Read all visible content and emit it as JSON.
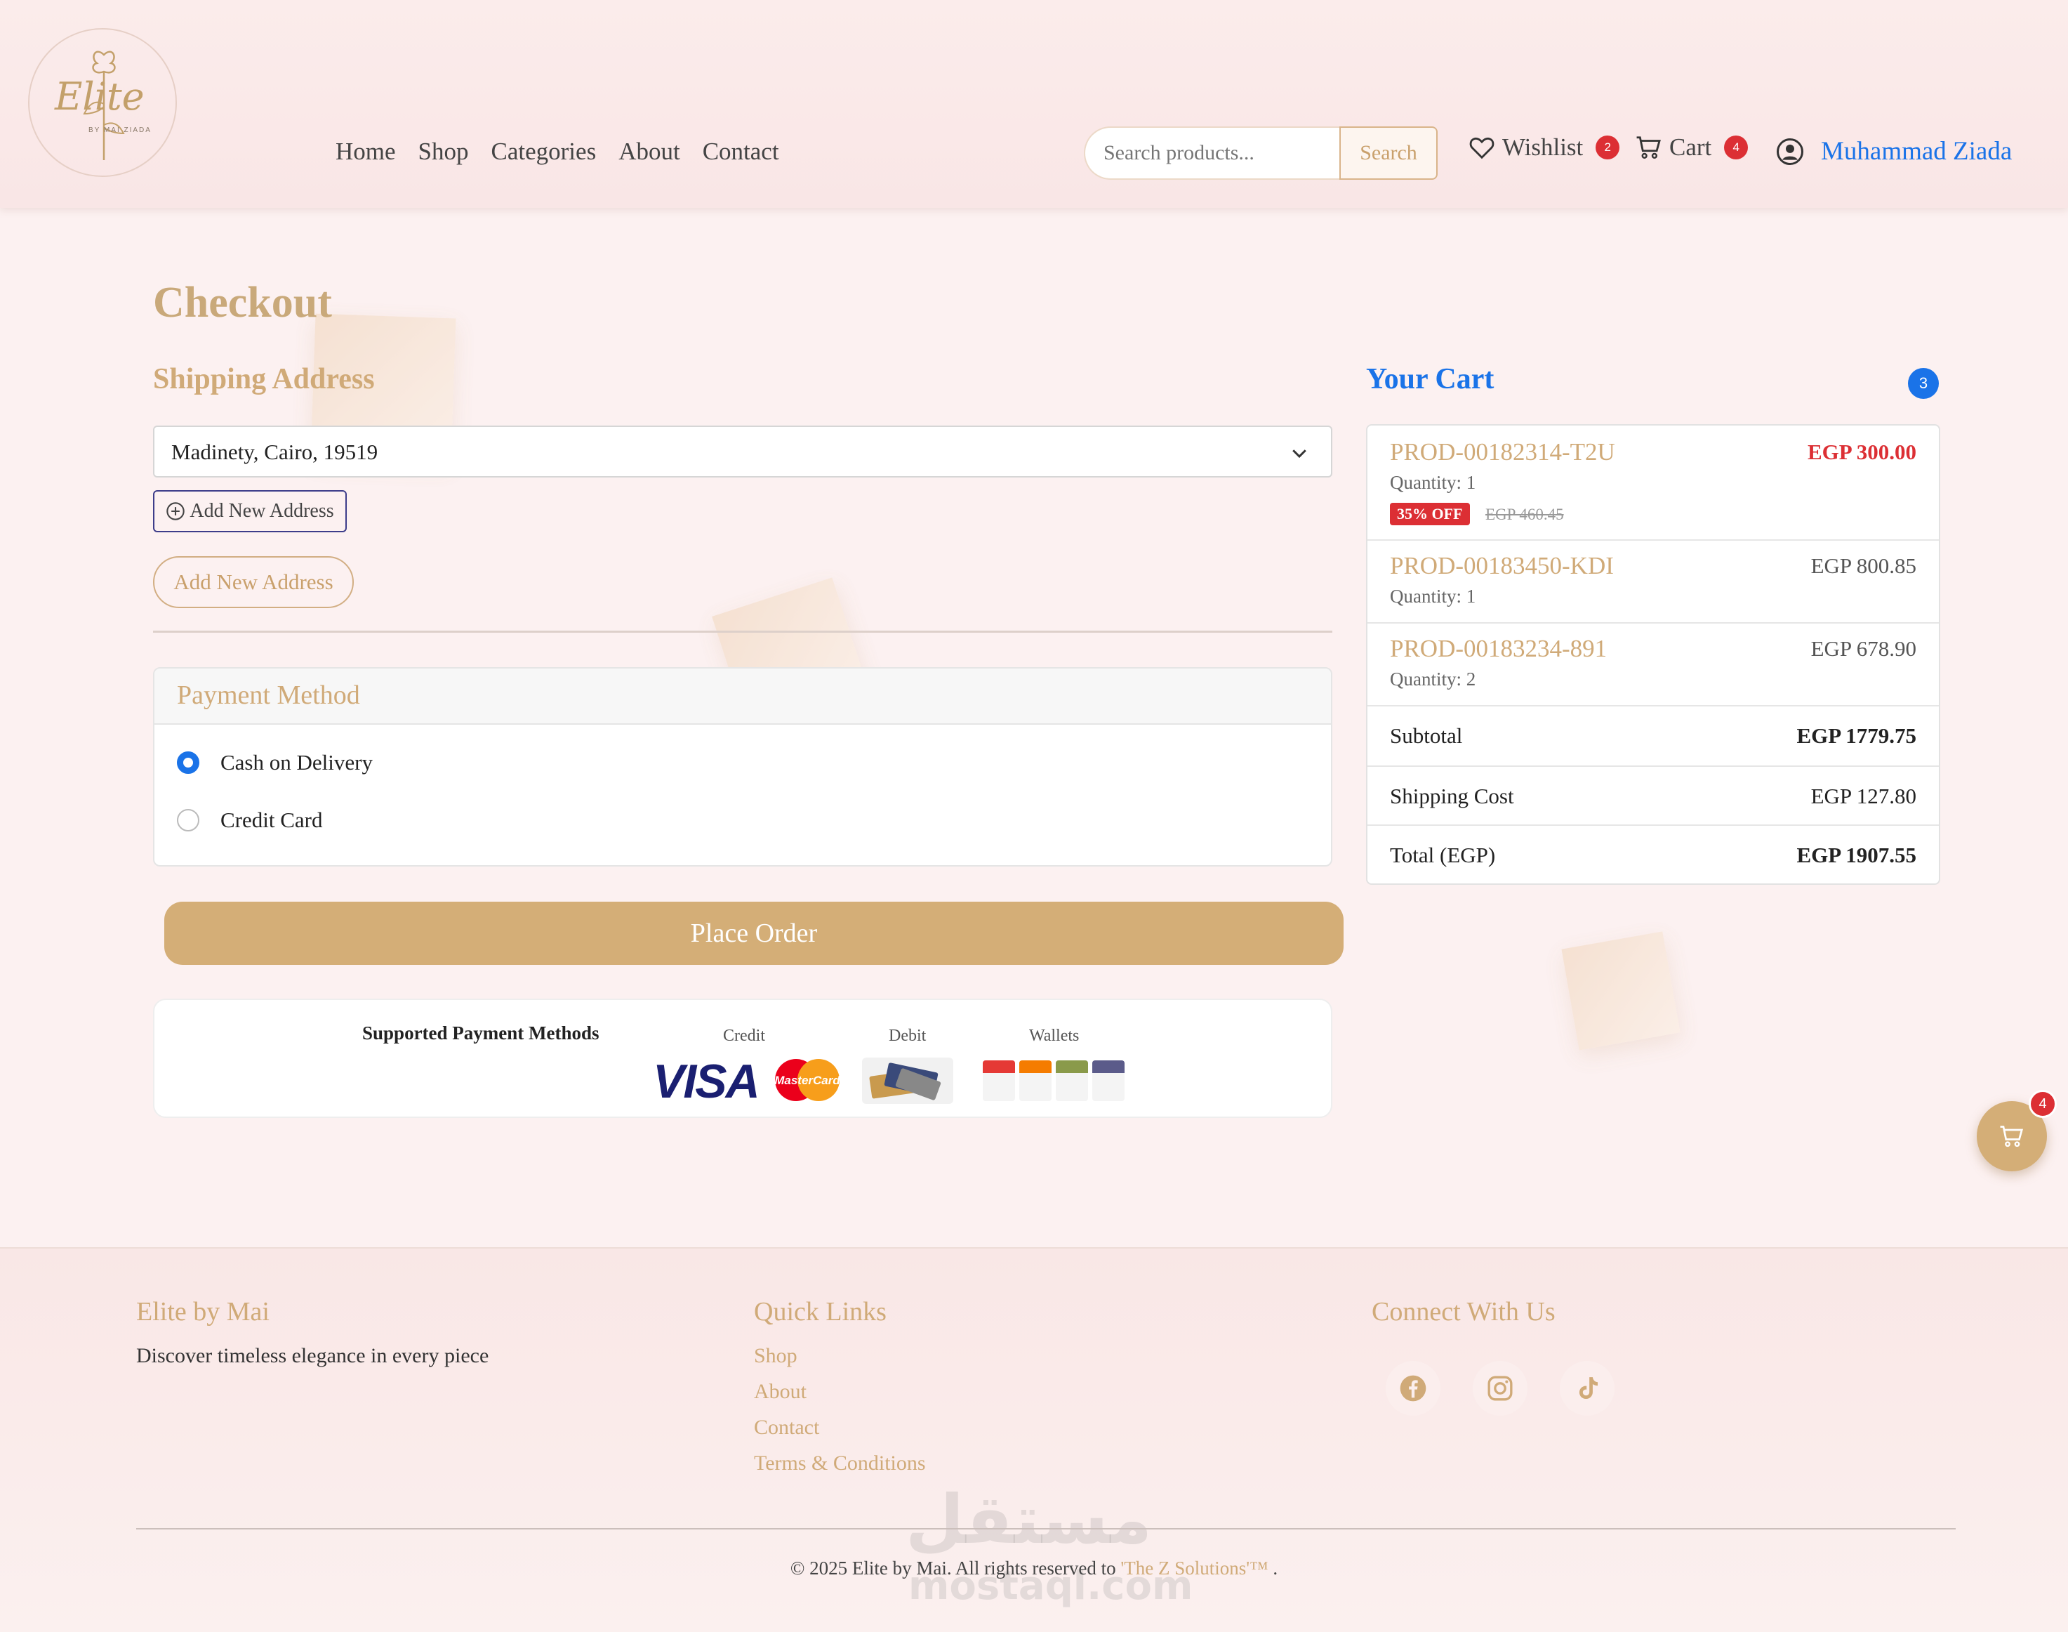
{
  "header": {
    "logo_text": "Elite",
    "logo_subtext": "BY MAI ZIADA",
    "nav": [
      "Home",
      "Shop",
      "Categories",
      "About",
      "Contact"
    ],
    "search_placeholder": "Search products...",
    "search_button": "Search",
    "wishlist_label": "Wishlist",
    "wishlist_count": "2",
    "cart_label": "Cart",
    "cart_count": "4",
    "user_name": "Muhammad Ziada"
  },
  "checkout": {
    "title": "Checkout",
    "shipping_title": "Shipping Address",
    "selected_address": "Madinety, Cairo, 19519",
    "add_address_small": "Add New Address",
    "add_address_pill": "Add New Address",
    "payment_title": "Payment Method",
    "payment_options": [
      "Cash on Delivery",
      "Credit Card"
    ],
    "selected_payment": "Cash on Delivery",
    "place_order": "Place Order",
    "supported_title": "Supported Payment Methods",
    "method_labels": [
      "Credit",
      "Debit",
      "Wallets"
    ],
    "visa_text": "VISA",
    "mastercard_text": "MasterCard"
  },
  "cart": {
    "title": "Your Cart",
    "count": "3",
    "items": [
      {
        "name": "PROD-00182314-T2U",
        "quantity": "Quantity: 1",
        "price": "EGP 300.00",
        "discount": "35% OFF",
        "old_price": "EGP 460.45"
      },
      {
        "name": "PROD-00183450-KDI",
        "quantity": "Quantity: 1",
        "price": "EGP 800.85"
      },
      {
        "name": "PROD-00183234-891",
        "quantity": "Quantity: 2",
        "price": "EGP 678.90"
      }
    ],
    "subtotal_label": "Subtotal",
    "subtotal_value": "EGP 1779.75",
    "shipping_label": "Shipping Cost",
    "shipping_value": "EGP 127.80",
    "total_label": "Total (EGP)",
    "total_value": "EGP 1907.55"
  },
  "floating_cart_count": "4",
  "footer": {
    "brand_title": "Elite by Mai",
    "brand_text": "Discover timeless elegance in every piece",
    "links_title": "Quick Links",
    "links": [
      "Shop",
      "About",
      "Contact",
      "Terms & Conditions"
    ],
    "connect_title": "Connect With Us",
    "social_icons": [
      "facebook-icon",
      "instagram-icon",
      "tiktok-icon"
    ],
    "copyright_prefix": "© 2025 Elite by Mai. All rights reserved to",
    "copyright_company": "'The Z Solutions'™",
    "copyright_suffix": "."
  },
  "watermark": {
    "arabic": "مستقل",
    "latin": "mostaql.com"
  },
  "colors": {
    "gold": "#d4ae77",
    "blue": "#1a73e8",
    "red": "#dc2f34",
    "background": "#fcf1f1"
  }
}
